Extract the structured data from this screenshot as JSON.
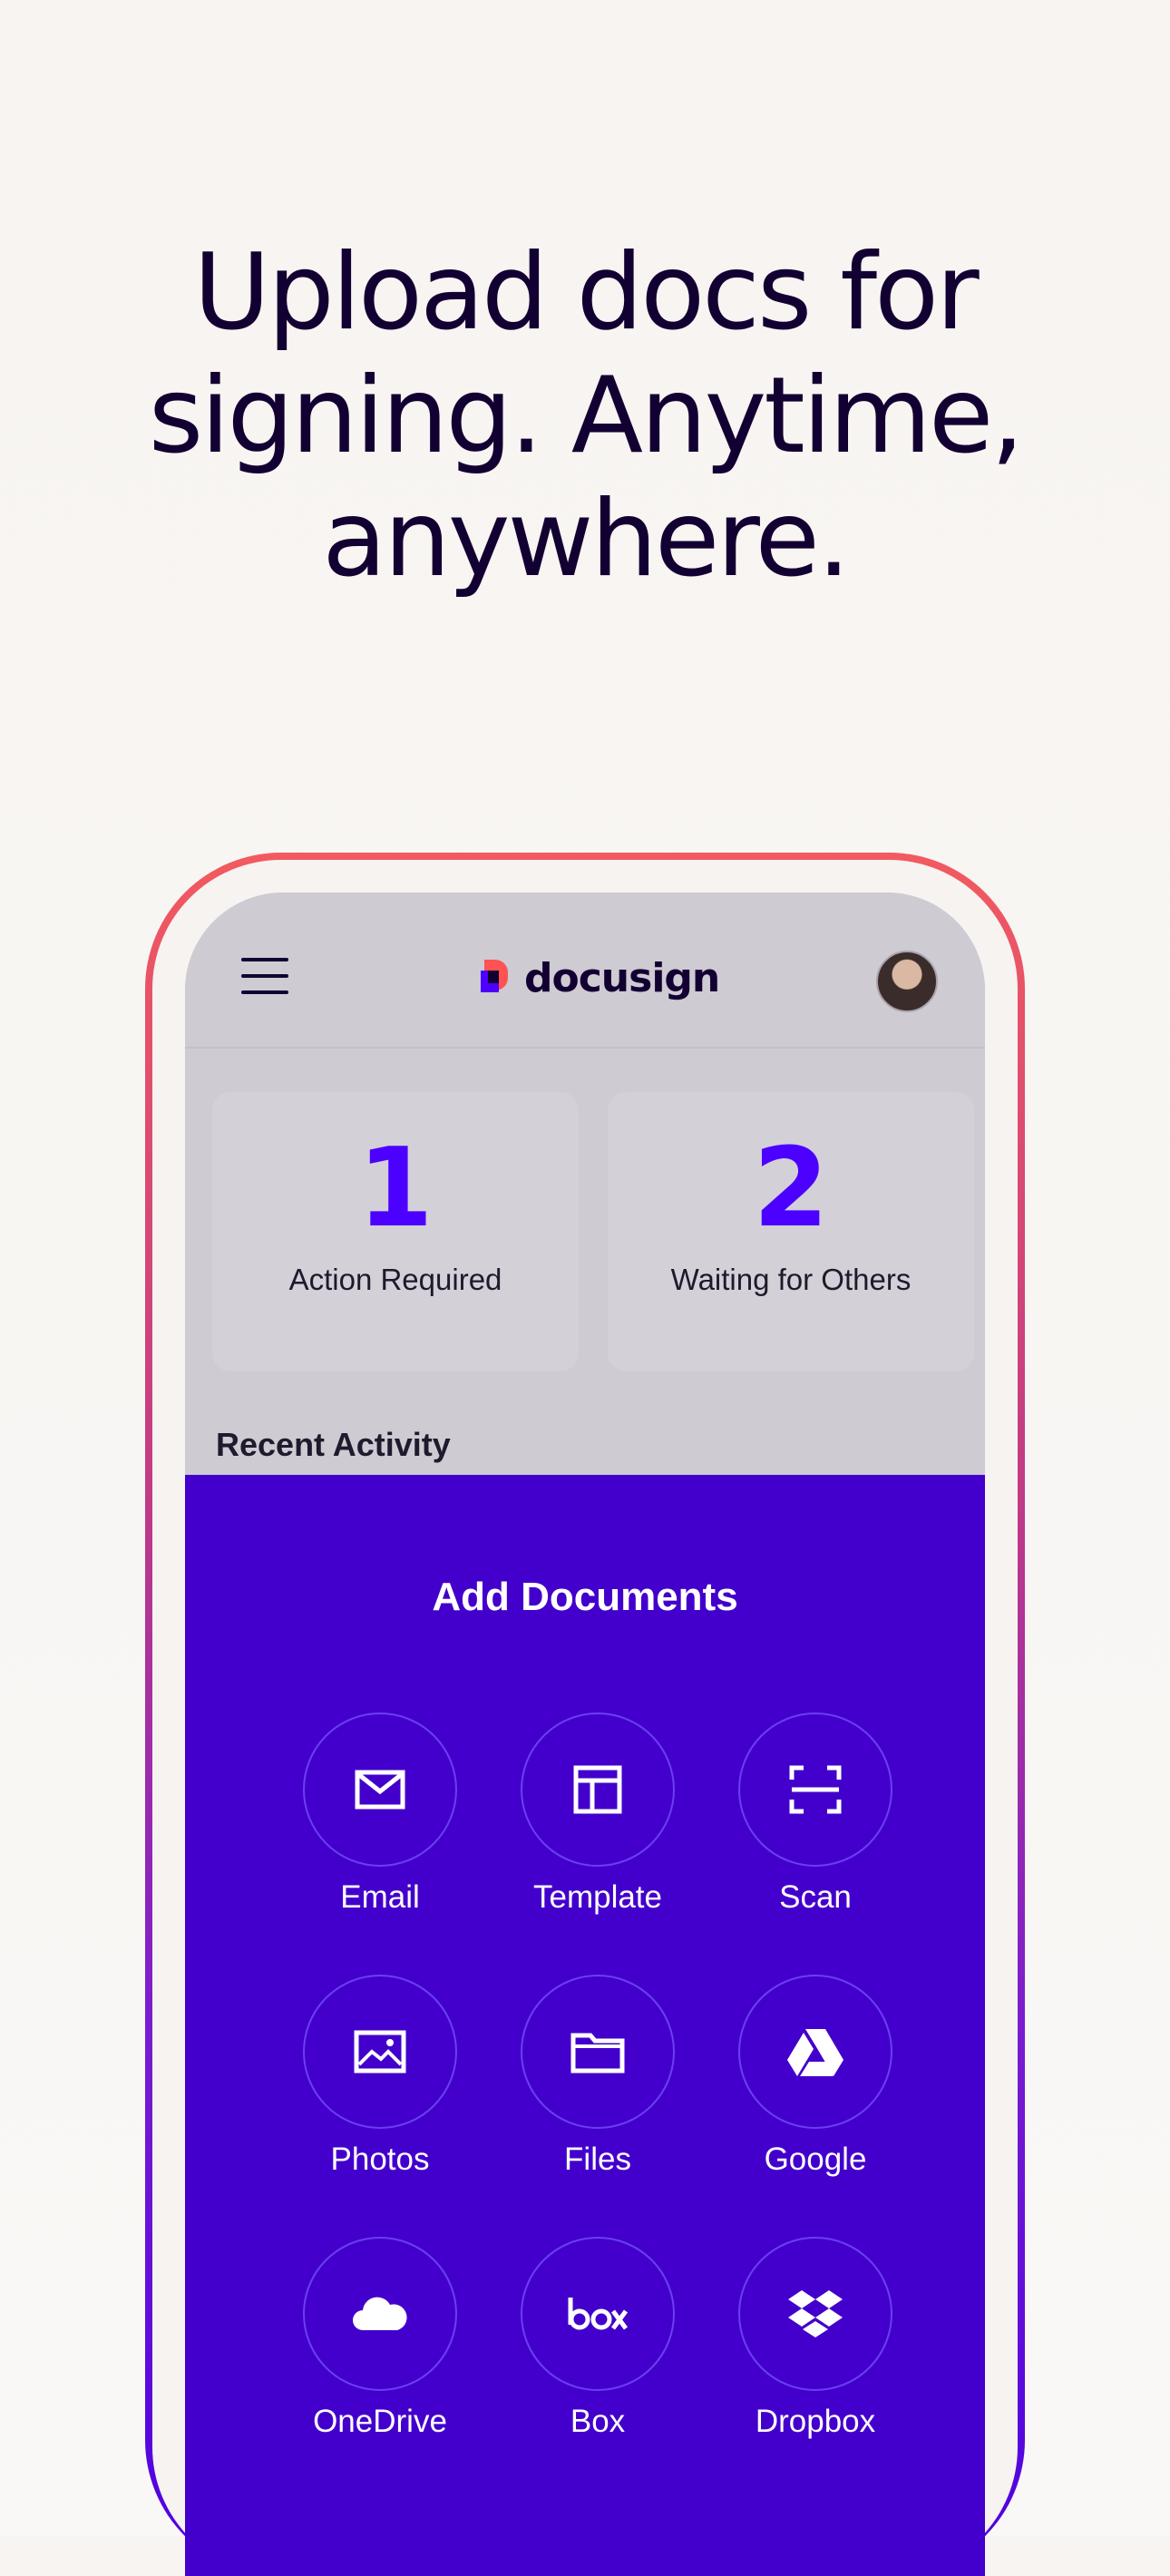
{
  "headline": {
    "line1": "Upload docs for",
    "line2": "signing. Anytime,",
    "line3": "anywhere."
  },
  "app": {
    "brand": "docusign",
    "colors": {
      "accent": "#4c00ff",
      "panel": "#4300cc",
      "frame_top": "#f25a5f",
      "frame_bottom": "#4c00e2"
    },
    "summary": [
      {
        "count": "1",
        "label": "Action Required"
      },
      {
        "count": "2",
        "label": "Waiting for Others"
      }
    ],
    "recent_activity_label": "Recent Activity",
    "add_documents": {
      "title": "Add Documents",
      "options": [
        {
          "label": "Email",
          "icon": "email-icon"
        },
        {
          "label": "Template",
          "icon": "template-icon"
        },
        {
          "label": "Scan",
          "icon": "scan-icon"
        },
        {
          "label": "Photos",
          "icon": "photos-icon"
        },
        {
          "label": "Files",
          "icon": "folder-icon"
        },
        {
          "label": "Google",
          "icon": "google-drive-icon"
        },
        {
          "label": "OneDrive",
          "icon": "onedrive-cloud-icon"
        },
        {
          "label": "Box",
          "icon": "box-icon"
        },
        {
          "label": "Dropbox",
          "icon": "dropbox-icon"
        }
      ]
    }
  }
}
